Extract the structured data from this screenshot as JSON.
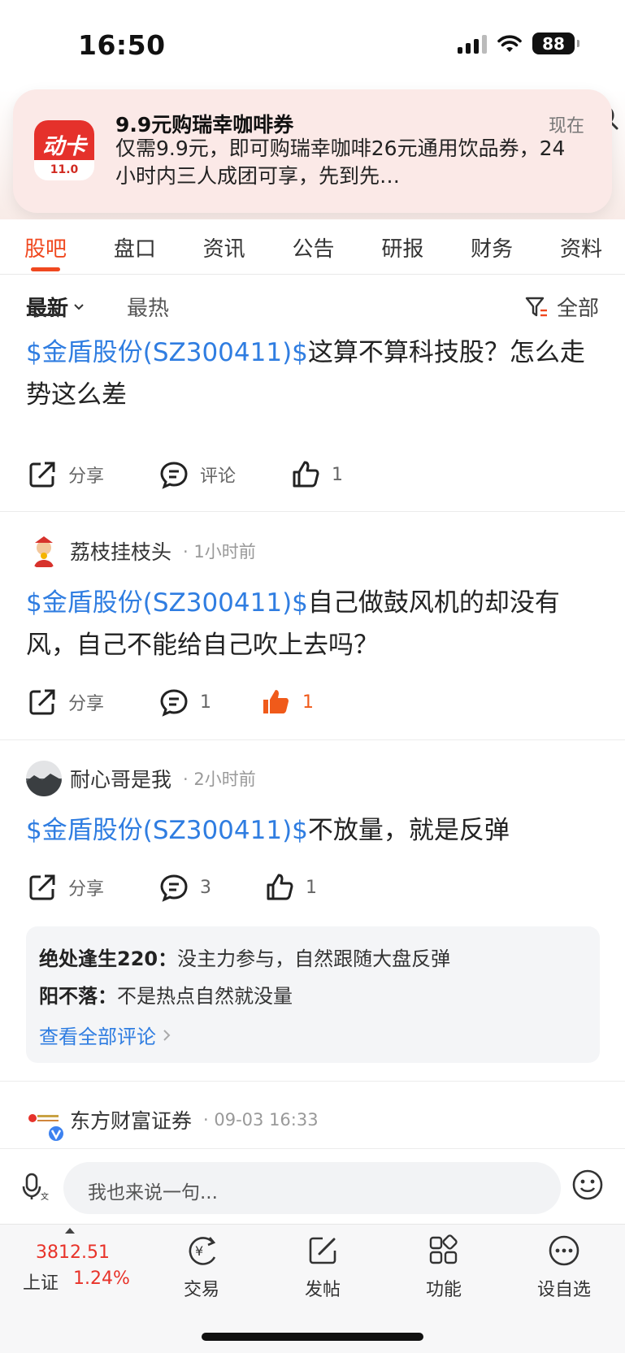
{
  "status_bar": {
    "time": "16:50",
    "battery": "88",
    "icons": [
      "signal-icon",
      "wifi-icon",
      "battery-icon"
    ]
  },
  "notification": {
    "app_icon_text": "动卡",
    "app_version": "11.0",
    "title": "9.9元购瑞幸咖啡券",
    "time": "现在",
    "body": "仅需9.9元，即可购瑞幸咖啡26元通用饮品券，24小时内三人成团可享，先到先…"
  },
  "tabs": [
    {
      "label": "股吧",
      "active": true
    },
    {
      "label": "盘口"
    },
    {
      "label": "资讯"
    },
    {
      "label": "公告"
    },
    {
      "label": "研报"
    },
    {
      "label": "财务"
    },
    {
      "label": "资料"
    }
  ],
  "filter": {
    "newest": "最新",
    "hottest": "最热",
    "all": "全部"
  },
  "posts": [
    {
      "stock": "$金盾股份(SZ300411)$",
      "text": "这算不算科技股？怎么走势这么差",
      "share": "分享",
      "comment": "评论",
      "likes": "1"
    },
    {
      "author": "荔枝挂枝头",
      "time": "· 1小时前",
      "stock": "$金盾股份(SZ300411)$",
      "text": "自己做鼓风机的却没有风，自己不能给自己吹上去吗？",
      "share": "分享",
      "comment": "1",
      "likes": "1"
    },
    {
      "author": "耐心哥是我",
      "time": "· 2小时前",
      "stock": "$金盾股份(SZ300411)$",
      "text": "不放量，就是反弹",
      "share": "分享",
      "comment": "3",
      "likes": "1",
      "replies": [
        {
          "user": "绝处逢生220：",
          "text": "没主力参与，自然跟随大盘反弹"
        },
        {
          "user": "阳不落：",
          "text": "不是热点自然就没量"
        }
      ],
      "view_all": "查看全部评论"
    },
    {
      "author": "东方财富证券",
      "time": "· 09-03 16:33"
    }
  ],
  "comment_bar": {
    "placeholder": "我也来说一句..."
  },
  "bottom_nav": {
    "index_value": "3812.51",
    "index_name": "上证",
    "index_change": "1.24%",
    "items": [
      {
        "label": "交易"
      },
      {
        "label": "发帖"
      },
      {
        "label": "功能"
      },
      {
        "label": "设自选"
      }
    ]
  },
  "colors": {
    "accent": "#f0481f",
    "link": "#2f7de1",
    "up": "#e8332a"
  }
}
